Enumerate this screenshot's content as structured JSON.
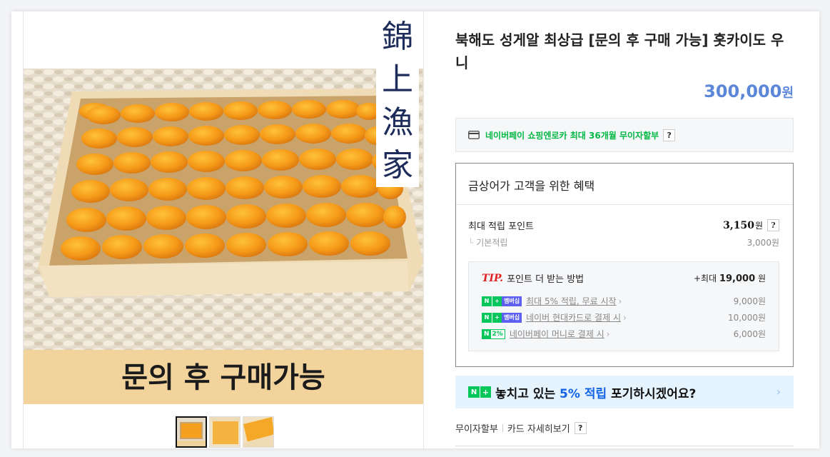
{
  "product": {
    "title": "북해도 성게알 최상급 [문의 후 구매 가능] 홋카이도 우니",
    "price": "300,000",
    "currency": "원",
    "image_banner": "문의 후 구매가능",
    "image_vertical_brand": [
      "錦",
      "上",
      "漁",
      "家"
    ],
    "thumbnails": [
      "thumb-1",
      "thumb-2",
      "thumb-3"
    ]
  },
  "npay": {
    "text": "네이버페이 쇼핑엔로카 최대 36개월 무이자할부",
    "help": "?"
  },
  "benefit": {
    "heading": "금상어가 고객을 위한 혜택",
    "max_points_label": "최대 적립 포인트",
    "max_points_value": "3,150",
    "unit": "원",
    "help": "?",
    "basic_label": "기본적립",
    "basic_value": "3,000원",
    "tip": {
      "mark": "TIP.",
      "title": "포인트 더 받는 방법",
      "max_prefix": "+최대",
      "max_value": "19,000",
      "max_unit": "원",
      "items": [
        {
          "badge": "멤버십",
          "label": "최대 5% 적립, 무료 시작",
          "amount": "9,000원"
        },
        {
          "badge": "멤버십",
          "label": "네이버 현대카드로 결제 시",
          "amount": "10,000원"
        },
        {
          "badge": "2%",
          "label": "네이버페이 머니로 결제 시",
          "amount": "6,000원"
        }
      ]
    }
  },
  "promo": {
    "text_before": "놓치고 있는",
    "highlight": "5% 적립",
    "text_after": "포기하시겠어요?"
  },
  "footer": {
    "installment": "무이자할부",
    "card_detail": "카드 자세히보기",
    "help": "?"
  },
  "colors": {
    "price": "#5c86d8",
    "naver_green": "#03c75a",
    "promo_bg": "#e4f3fe",
    "promo_highlight": "#1463e6"
  }
}
